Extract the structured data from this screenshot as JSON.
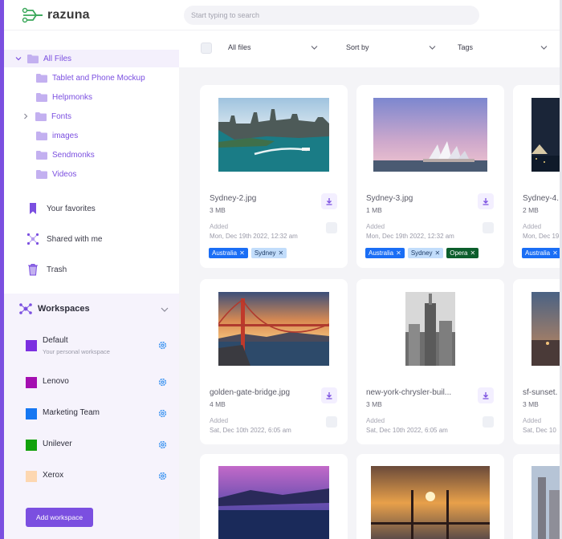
{
  "app": {
    "name": "razuna"
  },
  "search": {
    "placeholder": "Start typing to search"
  },
  "colors": {
    "accent": "#7b4fe0",
    "tag_blue": "#1a6ef5",
    "tag_light": "#c2ddfb",
    "tag_green": "#0c5e2c"
  },
  "sidebar": {
    "tree": [
      {
        "label": "All Files",
        "expanded": true,
        "selected": true
      },
      {
        "label": "Tablet and Phone Mockup"
      },
      {
        "label": "Helpmonks"
      },
      {
        "label": "Fonts",
        "collapsible": true
      },
      {
        "label": "images"
      },
      {
        "label": "Sendmonks"
      },
      {
        "label": "Videos"
      }
    ],
    "nav": [
      {
        "label": "Your favorites",
        "icon": "bookmark-icon"
      },
      {
        "label": "Shared with me",
        "icon": "share-icon"
      },
      {
        "label": "Trash",
        "icon": "trash-icon"
      }
    ],
    "workspaces": {
      "title": "Workspaces",
      "items": [
        {
          "name": "Default",
          "subtitle": "Your personal workspace",
          "color": "#7b2fe0"
        },
        {
          "name": "Lenovo",
          "subtitle": "",
          "color": "#a40fb1"
        },
        {
          "name": "Marketing Team",
          "subtitle": "",
          "color": "#1677f2"
        },
        {
          "name": "Unilever",
          "subtitle": "",
          "color": "#12a10b"
        },
        {
          "name": "Xerox",
          "subtitle": "",
          "color": "#fdd7b1"
        }
      ],
      "add_label": "Add workspace"
    }
  },
  "toolbar": {
    "filter": "All files",
    "sort": "Sort by",
    "tags": "Tags"
  },
  "files": [
    {
      "name": "Sydney-2.jpg",
      "size": "3 MB",
      "added_label": "Added",
      "date": "Mon, Dec 19th 2022, 12:32 am",
      "tags": [
        {
          "label": "Australia",
          "style": "blue"
        },
        {
          "label": "Sydney",
          "style": "light"
        }
      ]
    },
    {
      "name": "Sydney-3.jpg",
      "size": "1 MB",
      "added_label": "Added",
      "date": "Mon, Dec 19th 2022, 12:32 am",
      "tags": [
        {
          "label": "Australia",
          "style": "blue"
        },
        {
          "label": "Sydney",
          "style": "light"
        },
        {
          "label": "Opera",
          "style": "green"
        }
      ]
    },
    {
      "name": "Sydney-4.",
      "size": "2 MB",
      "added_label": "Added",
      "date": "Mon, Dec 19",
      "tags": [
        {
          "label": "Australia",
          "style": "blue"
        }
      ]
    },
    {
      "name": "golden-gate-bridge.jpg",
      "size": "4 MB",
      "added_label": "Added",
      "date": "Sat, Dec 10th 2022, 6:05 am",
      "tags": []
    },
    {
      "name": "new-york-chrysler-buil...",
      "size": "3 MB",
      "added_label": "Added",
      "date": "Sat, Dec 10th 2022, 6:05 am",
      "tags": []
    },
    {
      "name": "sf-sunset.",
      "size": "3 MB",
      "added_label": "Added",
      "date": "Sat, Dec 10",
      "tags": []
    },
    {
      "name": "",
      "size": "",
      "added_label": "",
      "date": "",
      "tags": []
    },
    {
      "name": "",
      "size": "",
      "added_label": "",
      "date": "",
      "tags": []
    },
    {
      "name": "",
      "size": "",
      "added_label": "",
      "date": "",
      "tags": []
    }
  ]
}
